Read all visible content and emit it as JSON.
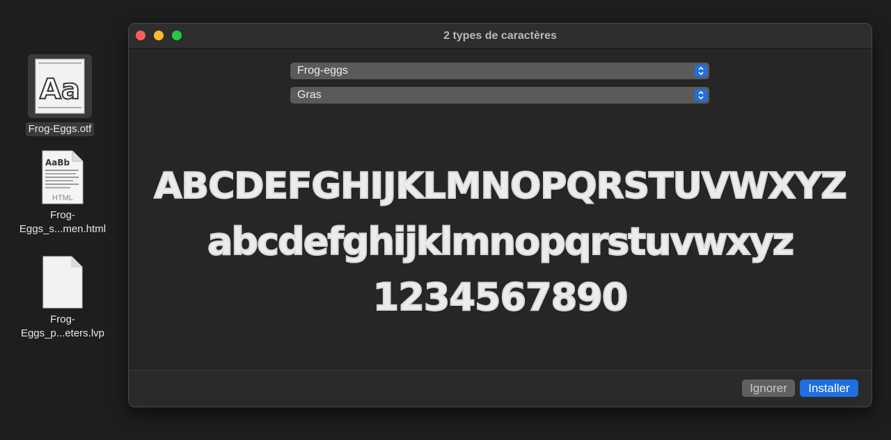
{
  "desktop": {
    "icons": [
      {
        "label": "Frog-Eggs.otf",
        "thumb_text": "Aa"
      },
      {
        "label_line1": "Frog-",
        "label_line2": "Eggs_s...men.html",
        "thumb_text": "AaBb",
        "thumb_tag": "HTML"
      },
      {
        "label_line1": "Frog-",
        "label_line2": "Eggs_p...eters.lvp"
      }
    ]
  },
  "window": {
    "title": "2 types de caractères",
    "family_select": "Frog-eggs",
    "style_select": "Gras",
    "sample_upper": "ABCDEFGHIJKLMNOPQRSTUVWXYZ",
    "sample_lower": "abcdefghijklmnopqrstuvwxyz",
    "sample_digits": "1234567890",
    "buttons": {
      "ignore": "Ignorer",
      "install": "Installer"
    }
  },
  "colors": {
    "accent": "#1f6fe0",
    "close": "#fe5f57",
    "minimize": "#febc2e",
    "zoom": "#28c840"
  }
}
